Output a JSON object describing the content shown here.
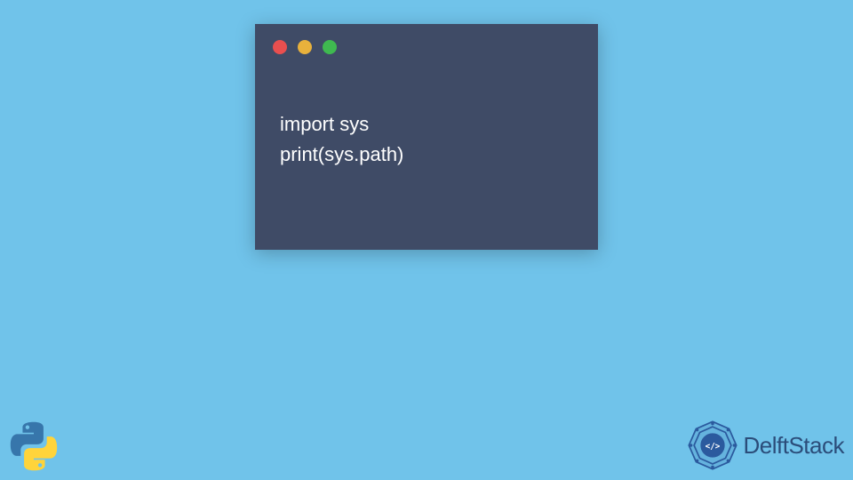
{
  "code": {
    "lines": [
      "import sys",
      "print(sys.path)"
    ]
  },
  "branding": {
    "delftstack_text": "DelftStack"
  },
  "colors": {
    "background": "#70c3ea",
    "window": "#3f4b66",
    "red": "#e94f4f",
    "yellow": "#e8b13c",
    "green": "#3fb950",
    "code_text": "#ffffff",
    "brand_text": "#2b4d7a"
  }
}
